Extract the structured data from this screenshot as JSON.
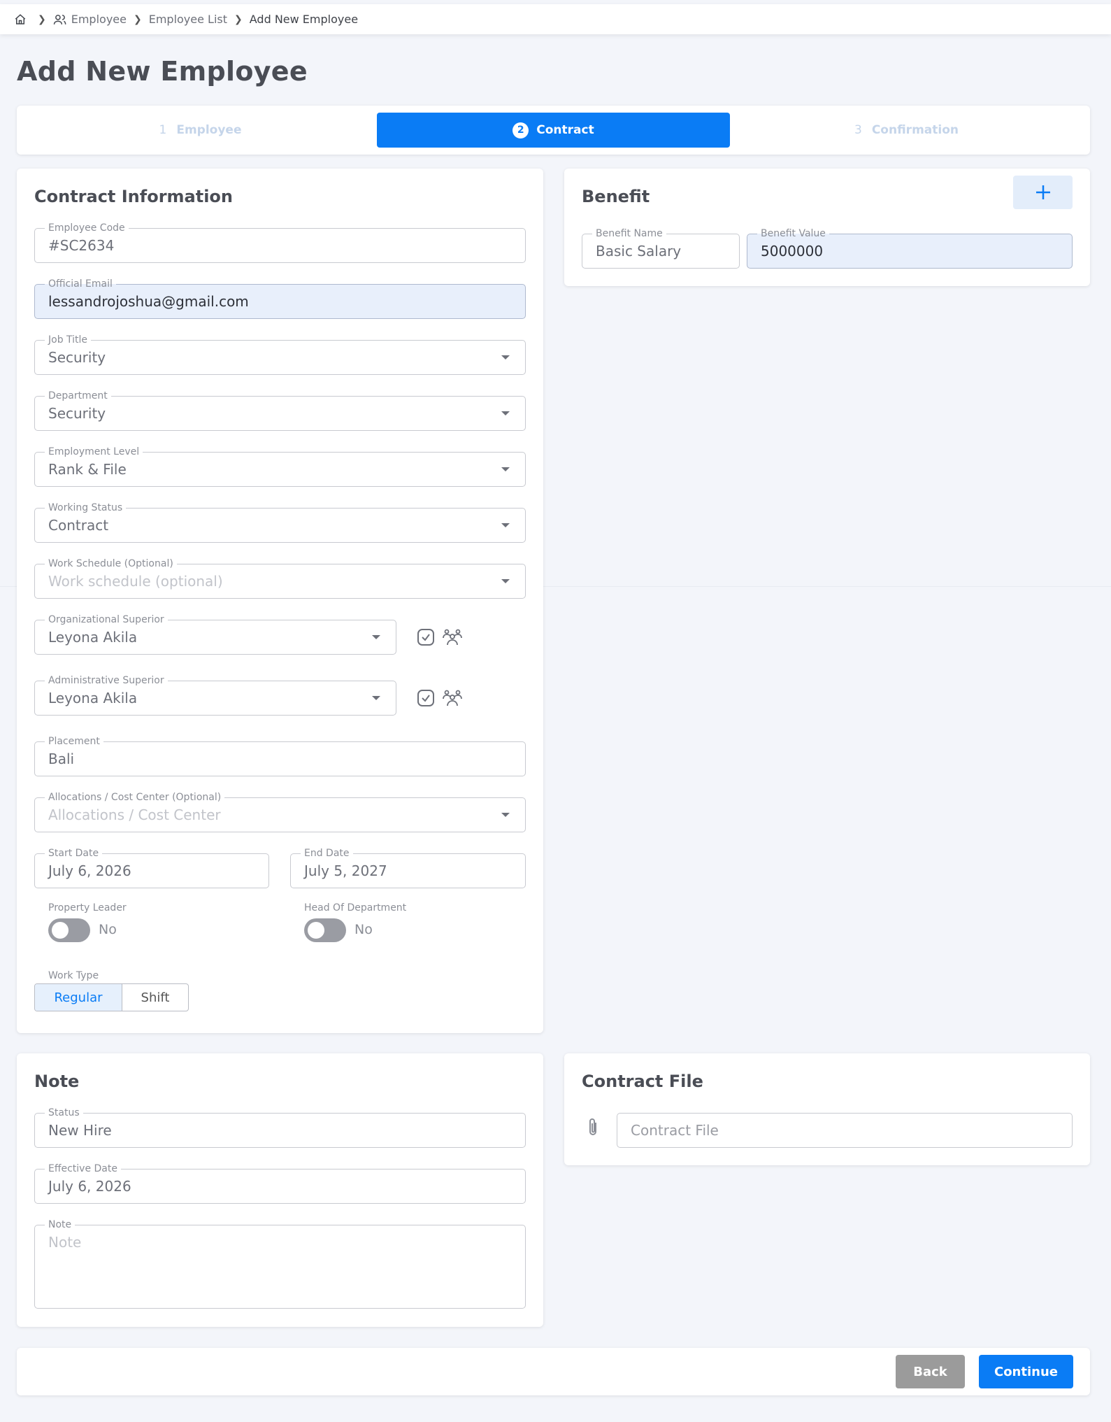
{
  "breadcrumb": {
    "items": [
      "Employee",
      "Employee List",
      "Add New Employee"
    ]
  },
  "page": {
    "title": "Add New Employee"
  },
  "stepper": {
    "steps": [
      {
        "num": "1",
        "label": "Employee"
      },
      {
        "num": "2",
        "label": "Contract"
      },
      {
        "num": "3",
        "label": "Confirmation"
      }
    ],
    "active_index": 1
  },
  "contract": {
    "title": "Contract Information",
    "employee_code": {
      "label": "Employee Code",
      "value": "#SC2634"
    },
    "official_email": {
      "label": "Official Email",
      "value": "lessandrojoshua@gmail.com"
    },
    "job_title": {
      "label": "Job Title",
      "value": "Security"
    },
    "department": {
      "label": "Department",
      "value": "Security"
    },
    "employment_level": {
      "label": "Employment Level",
      "value": "Rank & File"
    },
    "working_status": {
      "label": "Working Status",
      "value": "Contract"
    },
    "work_schedule": {
      "label": "Work Schedule (Optional)",
      "placeholder": "Work schedule (optional)"
    },
    "org_superior": {
      "label": "Organizational Superior",
      "value": "Leyona Akila"
    },
    "admin_superior": {
      "label": "Administrative Superior",
      "value": "Leyona Akila"
    },
    "placement": {
      "label": "Placement",
      "value": "Bali"
    },
    "allocations": {
      "label": "Allocations / Cost Center (Optional)",
      "placeholder": "Allocations / Cost Center"
    },
    "start_date": {
      "label": "Start Date",
      "value": "July 6, 2026"
    },
    "end_date": {
      "label": "End Date",
      "value": "July 5, 2027"
    },
    "property_leader": {
      "label": "Property Leader",
      "state": "No"
    },
    "head_of_department": {
      "label": "Head Of Department",
      "state": "No"
    },
    "work_type": {
      "label": "Work Type",
      "options": [
        "Regular",
        "Shift"
      ],
      "selected": "Regular"
    }
  },
  "benefit": {
    "title": "Benefit",
    "name": {
      "label": "Benefit Name",
      "value": "Basic Salary"
    },
    "value": {
      "label": "Benefit Value",
      "value": "5000000"
    }
  },
  "note": {
    "title": "Note",
    "status": {
      "label": "Status",
      "value": "New Hire"
    },
    "effective_date": {
      "label": "Effective Date",
      "value": "July 6, 2026"
    },
    "note": {
      "label": "Note",
      "placeholder": "Note"
    }
  },
  "contract_file": {
    "title": "Contract File",
    "placeholder": "Contract File"
  },
  "footer": {
    "back_label": "Back",
    "continue_label": "Continue"
  },
  "colors": {
    "primary": "#0a7cf5",
    "back": "#9b9b9b",
    "background": "#f3f5fa"
  }
}
